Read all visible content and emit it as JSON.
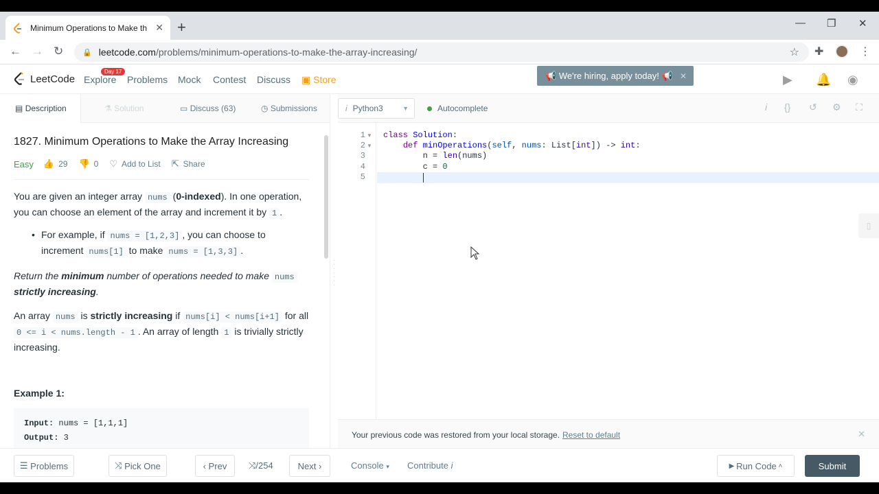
{
  "browser": {
    "tab_title": "Minimum Operations to Make th",
    "tab_close": "✕",
    "new_tab": "+",
    "url_host": "leetcode.com",
    "url_path": "/problems/minimum-operations-to-make-the-array-increasing/"
  },
  "nav": {
    "logo": "LeetCode",
    "explore": "Explore",
    "day_badge": "Day 17",
    "problems": "Problems",
    "mock": "Mock",
    "contest": "Contest",
    "discuss": "Discuss",
    "store": "Store",
    "hiring": "We're hiring, apply today!"
  },
  "subtabs": {
    "description": "Description",
    "solution": "Solution",
    "discuss": "Discuss (63)",
    "submissions": "Submissions"
  },
  "problem": {
    "title": "1827. Minimum Operations to Make the Array Increasing",
    "difficulty": "Easy",
    "likes": "29",
    "dislikes": "0",
    "add_to_list": "Add to List",
    "share": "Share"
  },
  "editor": {
    "language": "Python3",
    "autocomplete": "Autocomplete",
    "restore_msg": "Your previous code was restored from your local storage.",
    "reset": "Reset to default"
  },
  "bottom": {
    "problems": "Problems",
    "pick_one": "Pick One",
    "prev": "Prev",
    "counter": "/254",
    "next": "Next",
    "console": "Console",
    "contribute": "Contribute",
    "run_code": "Run Code",
    "submit": "Submit"
  },
  "colors": {
    "accent": "#455a64",
    "easy": "#43a047",
    "store": "#f0a020",
    "hiring_bg": "#78909c"
  }
}
